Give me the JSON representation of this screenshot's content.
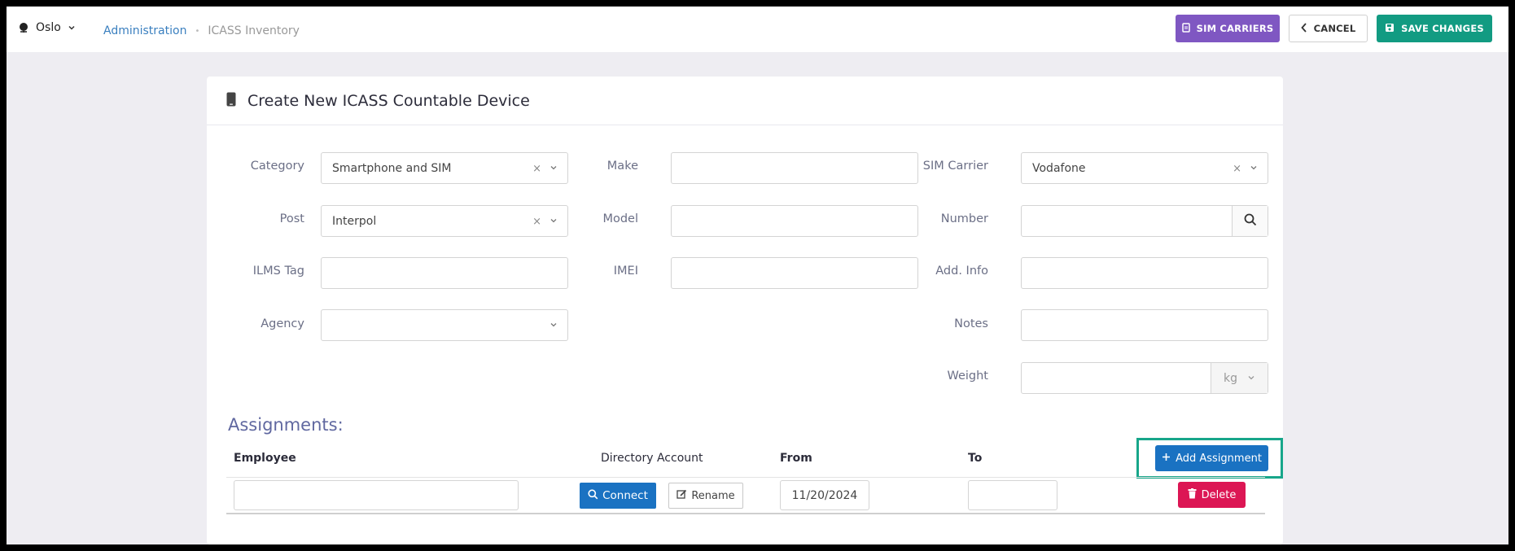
{
  "header": {
    "location": "Oslo",
    "breadcrumb": [
      "Administration",
      "ICASS Inventory"
    ],
    "buttons": {
      "sim_carriers": "SIM CARRIERS",
      "cancel": "CANCEL",
      "save_changes": "SAVE CHANGES"
    }
  },
  "form": {
    "title": "Create New ICASS Countable Device",
    "category": {
      "label": "Category",
      "value": "Smartphone and SIM"
    },
    "post": {
      "label": "Post",
      "value": "Interpol"
    },
    "ilms_tag": {
      "label": "ILMS Tag",
      "value": ""
    },
    "agency": {
      "label": "Agency",
      "value": ""
    },
    "make": {
      "label": "Make",
      "value": ""
    },
    "model": {
      "label": "Model",
      "value": ""
    },
    "imei": {
      "label": "IMEI",
      "value": ""
    },
    "sim_carrier": {
      "label": "SIM Carrier",
      "value": "Vodafone"
    },
    "number": {
      "label": "Number",
      "value": ""
    },
    "add_info": {
      "label": "Add. Info",
      "value": ""
    },
    "notes": {
      "label": "Notes",
      "value": ""
    },
    "weight": {
      "label": "Weight",
      "value": "",
      "unit": "kg"
    }
  },
  "assignments": {
    "title": "Assignments:",
    "columns": {
      "employee": "Employee",
      "directory_account": "Directory Account",
      "from": "From",
      "to": "To"
    },
    "add_button": "Add Assignment",
    "rows": [
      {
        "employee": "",
        "connect": "Connect",
        "rename": "Rename",
        "from": "11/20/2024",
        "to": "",
        "delete": "Delete"
      }
    ]
  },
  "colors": {
    "sim_carriers_button": "#7f57c2",
    "save_button": "#129b82",
    "primary_blue": "#1a72c2",
    "delete_red": "#dc1654",
    "highlight_box": "#17a68a"
  }
}
